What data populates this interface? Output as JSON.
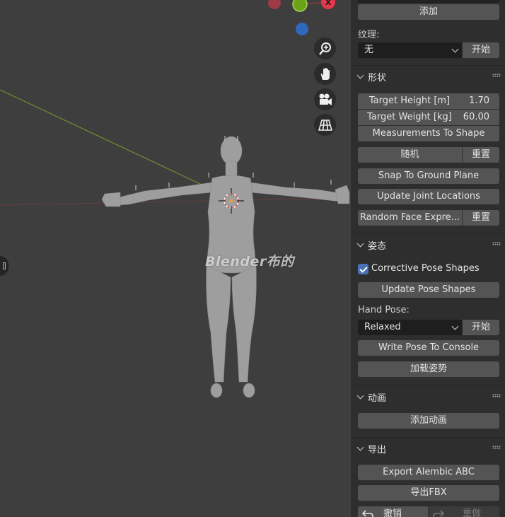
{
  "viewport": {
    "watermark": "Blender布的",
    "nav_icons": [
      "zoom-icon",
      "hand-icon",
      "camera-icon",
      "grid-icon"
    ]
  },
  "panel": {
    "add_button": "添加",
    "texture_label": "纹理:",
    "texture_value": "无",
    "texture_start": "开始",
    "shape": {
      "title": "形状",
      "target_height_label": "Target Height [m]",
      "target_height_value": "1.70",
      "target_weight_label": "Target Weight [kg]",
      "target_weight_value": "60.00",
      "measurements_to_shape": "Measurements To Shape",
      "random": "随机",
      "reset": "重置",
      "snap_to_ground": "Snap To Ground Plane",
      "update_joints": "Update Joint Locations",
      "random_face": "Random Face Expre...",
      "random_face_reset": "重置"
    },
    "pose": {
      "title": "姿态",
      "corrective_label": "Corrective Pose Shapes",
      "corrective_checked": true,
      "update_pose_shapes": "Update Pose Shapes",
      "hand_pose_label": "Hand Pose:",
      "hand_pose_value": "Relaxed",
      "hand_pose_start": "开始",
      "write_pose": "Write Pose To Console",
      "load_pose": "加载姿势"
    },
    "animation": {
      "title": "动画",
      "add_animation": "添加动画"
    },
    "export": {
      "title": "导出",
      "export_abc": "Export Alembic ABC",
      "export_fbx": "导出FBX",
      "undo": "撤销",
      "redo": "重做"
    }
  },
  "colors": {
    "viewport_bg": "#3e3e3e",
    "panel_bg": "#2e2e2e",
    "button": "#545454",
    "accent_blue": "#4772b3",
    "gizmo_red": "#e4384b",
    "gizmo_green": "#6aa318",
    "gizmo_blue": "#2f69bc"
  }
}
